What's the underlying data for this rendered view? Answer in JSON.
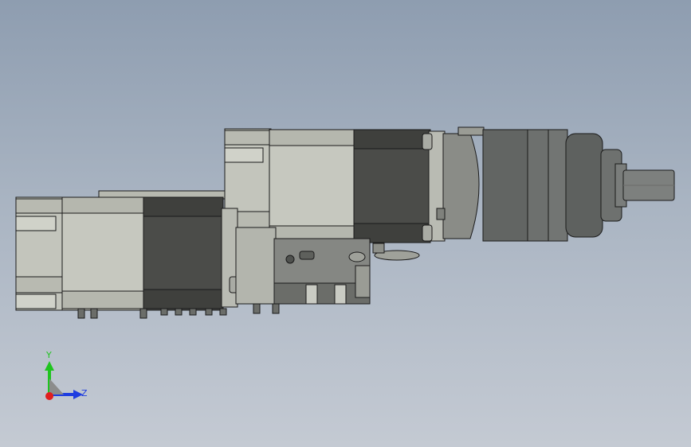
{
  "viewport": {
    "background_top": "#8e9db0",
    "background_bottom": "#c4cad3",
    "model_colors": {
      "light_body": "#c3c5bc",
      "dark_band": "#4b4c49",
      "mid_gray": "#9a9c95",
      "gearbox": "#6d706e",
      "outline": "#1a1a1a"
    }
  },
  "triad": {
    "y_label": "Y",
    "z_label": "Z",
    "y_color": "#1fc41f",
    "z_color": "#1e3de0",
    "x_color": "#e01e1e"
  }
}
